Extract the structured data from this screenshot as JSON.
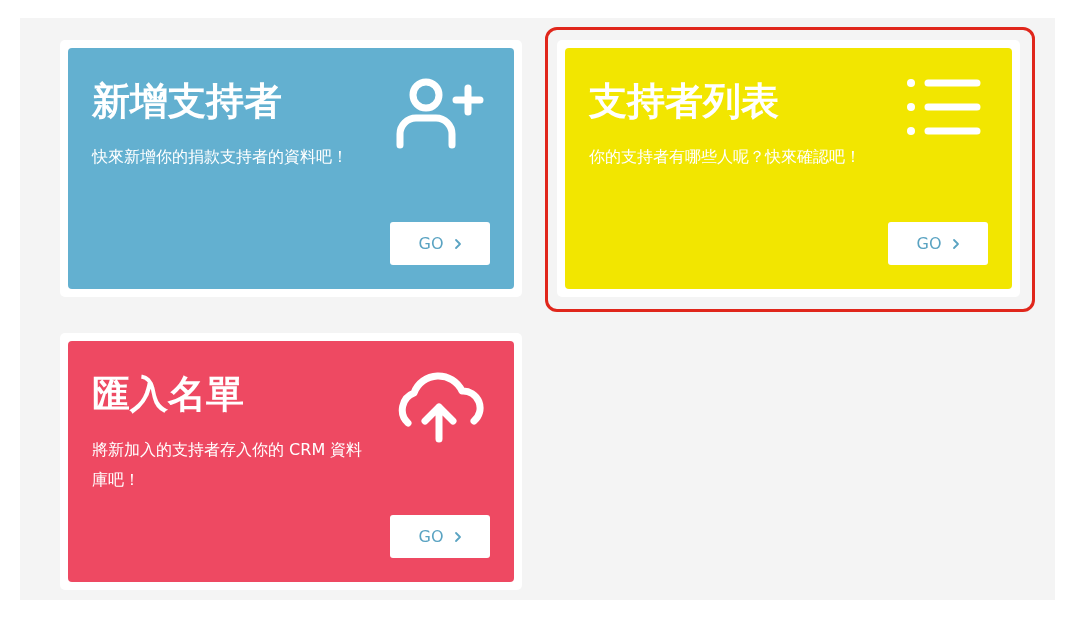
{
  "cards": [
    {
      "kind": "add",
      "title": "新增支持者",
      "description": "快來新增你的捐款支持者的資料吧！",
      "button": "GO",
      "color": "#63b0d0",
      "highlighted": false
    },
    {
      "kind": "list",
      "title": "支持者列表",
      "description": "你的支持者有哪些人呢？快來確認吧！",
      "button": "GO",
      "color": "#f2e600",
      "highlighted": true
    },
    {
      "kind": "import",
      "title": "匯入名單",
      "description": "將新加入的支持者存入你的 CRM 資料庫吧！",
      "button": "GO",
      "color": "#ee4962",
      "highlighted": false
    }
  ]
}
